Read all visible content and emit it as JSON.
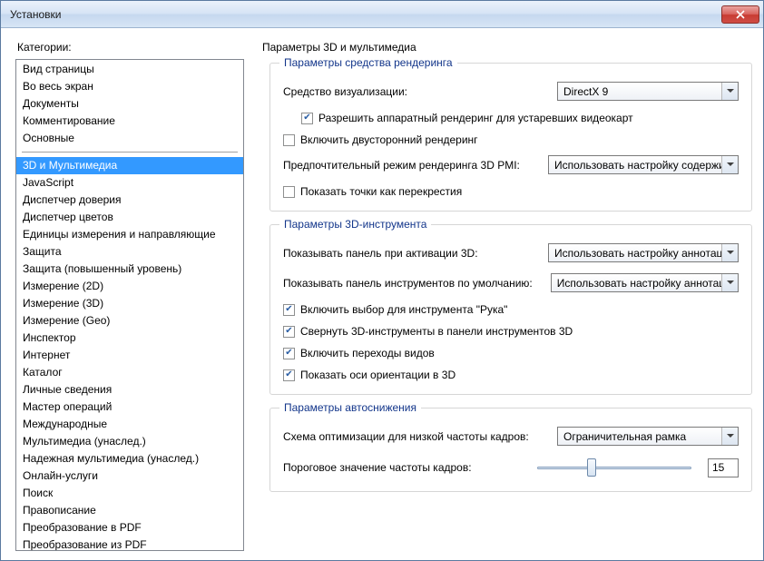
{
  "window": {
    "title": "Установки"
  },
  "categories_label": "Категории:",
  "categories": {
    "top": [
      "Вид страницы",
      "Во весь экран",
      "Документы",
      "Комментирование",
      "Основные"
    ],
    "rest": [
      "3D и Мультимедиа",
      "JavaScript",
      "Диспетчер доверия",
      "Диспетчер цветов",
      "Единицы измерения и направляющие",
      "Защита",
      "Защита (повышенный уровень)",
      "Измерение (2D)",
      "Измерение (3D)",
      "Измерение (Geo)",
      "Инспектор",
      "Интернет",
      "Каталог",
      "Личные сведения",
      "Мастер операций",
      "Международные",
      "Мультимедиа (унаслед.)",
      "Надежная мультимедиа (унаслед.)",
      "Онлайн-услуги",
      "Поиск",
      "Правописание",
      "Преобразование в PDF",
      "Преобразование из PDF"
    ],
    "selected": "3D и Мультимедиа"
  },
  "panel": {
    "title": "Параметры 3D и мультимедиа"
  },
  "render": {
    "legend": "Параметры средства рендеринга",
    "vis_label": "Средство визуализации:",
    "vis_value": "DirectX 9",
    "hw_legacy": "Разрешить аппаратный рендеринг для устаревших видеокарт",
    "double_sided": "Включить двусторонний рендеринг",
    "pmi_label": "Предпочтительный режим рендеринга 3D PMI:",
    "pmi_value": "Использовать настройку содержимого",
    "crosshair": "Показать точки как перекрестия"
  },
  "tool": {
    "legend": "Параметры 3D-инструмента",
    "show_panel_label": "Показывать панель при активации 3D:",
    "show_panel_value": "Использовать настройку аннотаций",
    "default_toolbar_label": "Показывать панель инструментов по умолчанию:",
    "default_toolbar_value": "Использовать настройку аннотаций",
    "hand_select": "Включить выбор для инструмента \"Рука\"",
    "collapse_tools": "Свернуть 3D-инструменты в панели инструментов 3D",
    "view_transitions": "Включить переходы видов",
    "orient_axes": "Показать оси ориентации в 3D"
  },
  "auto": {
    "legend": "Параметры автоснижения",
    "scheme_label": "Схема оптимизации для низкой частоты кадров:",
    "scheme_value": "Ограничительная рамка",
    "threshold_label": "Пороговое значение частоты кадров:",
    "threshold_value": "15",
    "slider_pos_pct": 35
  }
}
